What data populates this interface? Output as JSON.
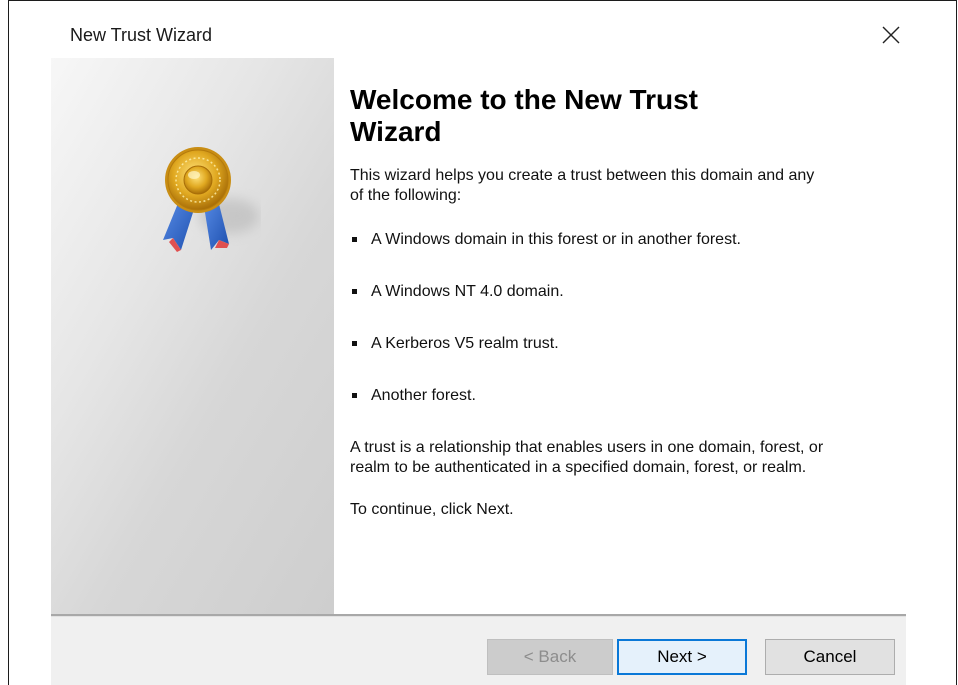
{
  "window": {
    "title": "New Trust Wizard",
    "close_icon": "close-icon"
  },
  "side_panel": {
    "icon": "award-medal-icon",
    "colors": {
      "medal_gold": "#d9a21a",
      "ribbon_blue": "#2b62c4",
      "ribbon_red": "#e05050"
    }
  },
  "content": {
    "heading_line1": "Welcome to the New Trust",
    "heading_line2": "Wizard",
    "intro": "This wizard helps you create a trust between this domain and any of the following:",
    "options": [
      "A Windows domain in this forest or in another forest.",
      "A Windows NT 4.0 domain.",
      "A Kerberos V5 realm trust.",
      "Another forest."
    ],
    "description": "A trust is a relationship that enables users in one domain, forest, or realm to be authenticated in a specified domain, forest, or realm.",
    "continue_text": "To continue, click Next."
  },
  "footer": {
    "back_label": "< Back",
    "back_enabled": false,
    "next_label": "Next >",
    "cancel_label": "Cancel",
    "accent_color": "#0a78d7"
  }
}
